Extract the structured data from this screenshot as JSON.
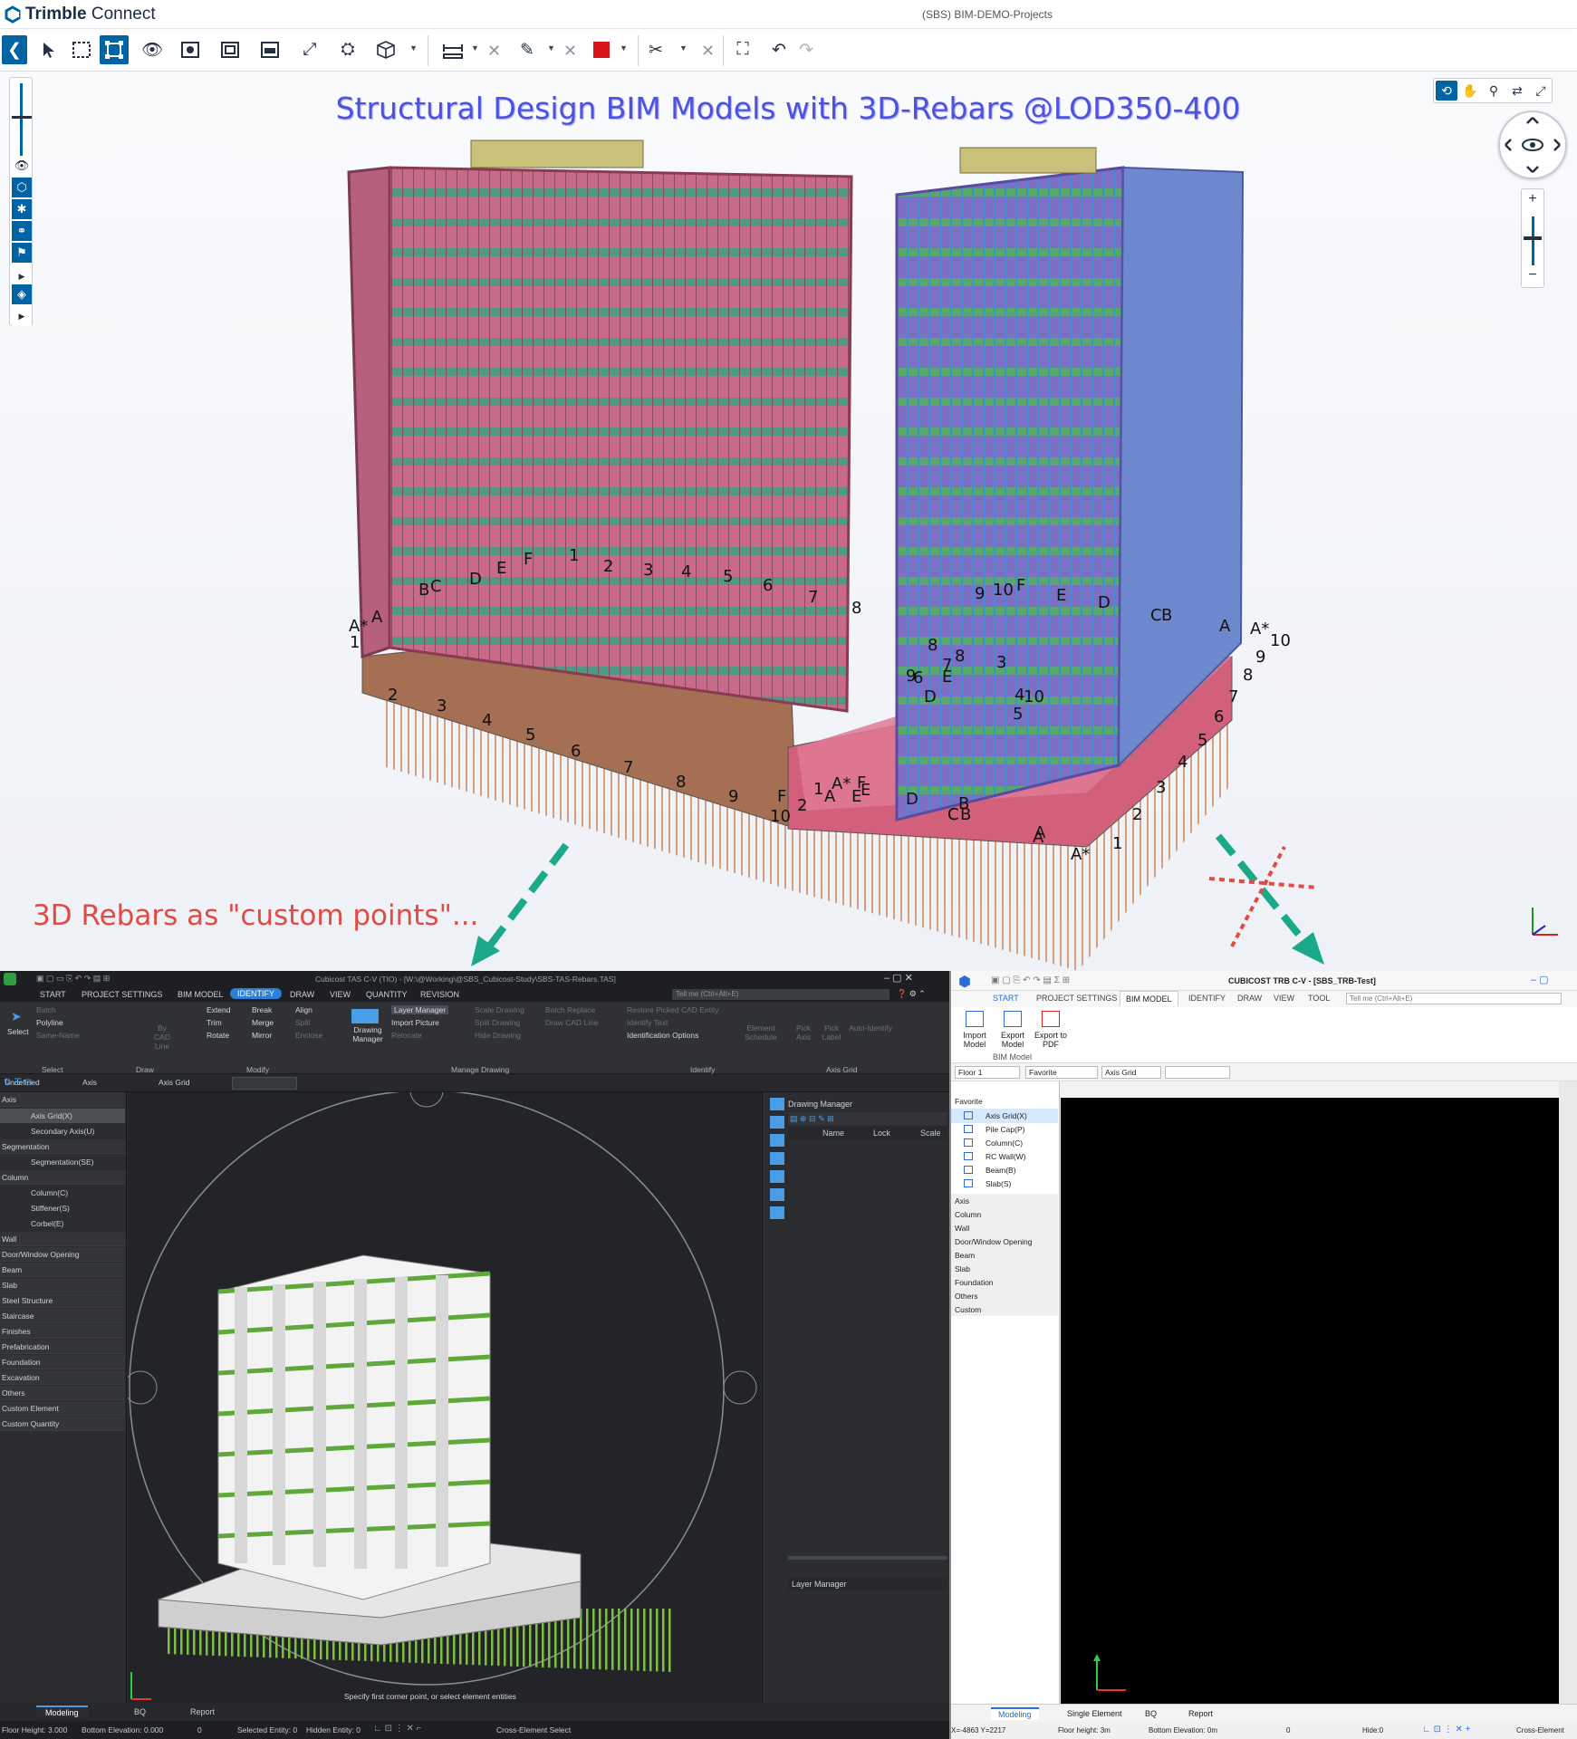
{
  "trimble": {
    "brand_bold": "Trimble",
    "brand_light": "Connect",
    "project": "(SBS) BIM-DEMO-Projects",
    "heading": "Structural Design BIM Models with 3D-Rebars @LOD350-400",
    "caption": "3D Rebars as \"custom points\"...",
    "zoom_plus": "+",
    "zoom_minus": "−",
    "grid_labels_left": [
      "A*",
      "A",
      "1",
      "B",
      "C",
      "D",
      "E",
      "F",
      "1",
      "2",
      "3",
      "4",
      "5",
      "6",
      "7",
      "8",
      "2",
      "3",
      "4",
      "5",
      "6",
      "7",
      "8",
      "9",
      "10",
      "1",
      "2",
      "F",
      "E",
      "A",
      "A*"
    ],
    "grid_labels_right": [
      "9",
      "10",
      "F",
      "E",
      "D",
      "C",
      "B",
      "A",
      "A*",
      "10",
      "9",
      "8",
      "7",
      "6",
      "5",
      "4",
      "3",
      "2",
      "1",
      "A*",
      "A",
      "B",
      "C",
      "D",
      "E",
      "F",
      "5",
      "4",
      "3",
      "8",
      "9",
      "6",
      "7",
      "8",
      "D",
      "E",
      "A",
      "C",
      "B",
      "10"
    ],
    "accent": "#0063a3"
  },
  "tas": {
    "title": "Cubicost TAS C-V (TIO) - [W:\\@Working\\@SBS_Cubicost-Study\\SBS-TAS-Rebars.TAS]",
    "tabs": [
      "START",
      "PROJECT SETTINGS",
      "BIM MODEL",
      "IDENTIFY",
      "DRAW",
      "VIEW",
      "QUANTITY",
      "REVISION"
    ],
    "tell_me": "Tell me (Ctrl+Alt+E)",
    "ribbon": {
      "select": "Select",
      "batch": "Batch",
      "polyline": "Polyline",
      "same_name": "Same-Name",
      "by_cad_line": "By CAD Line",
      "extend": "Extend",
      "break": "Break",
      "align": "Align",
      "trim": "Trim",
      "merge": "Merge",
      "split": "Split",
      "rotate": "Rotate",
      "mirror": "Mirror",
      "enclose": "Enclose",
      "drawing_manager": "Drawing Manager",
      "layer_manager": "Layer Manager",
      "import_picture": "Import Picture",
      "relocate": "Relocate",
      "scale_drawing": "Scale Drawing",
      "split_drawing": "Split Drawing",
      "hide_drawing": "Hide Drawing",
      "batch_replace": "Batch Replace",
      "draw_cad_line": "Draw CAD Line",
      "restore": "Restore Picked CAD Entity",
      "identify_text": "Identify Text",
      "identification_options": "Identification Options",
      "element_schedule": "Element Schedule",
      "pick_axis": "Pick Axis",
      "pick_label": "Pick Label",
      "auto_identify": "Auto-Identify"
    },
    "groups": [
      "Select",
      "Draw",
      "Modify",
      "Manage Drawing",
      "Identify",
      "Axis Grid"
    ],
    "filter": [
      "Undefined",
      "Axis",
      "Axis Grid",
      ""
    ],
    "tree": [
      {
        "t": "Axis",
        "k": "head"
      },
      {
        "t": "Axis Grid(X)",
        "k": "sel"
      },
      {
        "t": "Secondary Axis(U)",
        "k": "sub"
      },
      {
        "t": "Segmentation",
        "k": "head"
      },
      {
        "t": "Segmentation(SE)",
        "k": "sub"
      },
      {
        "t": "Column",
        "k": "head"
      },
      {
        "t": "Column(C)",
        "k": "sub"
      },
      {
        "t": "Stiffener(S)",
        "k": "sub"
      },
      {
        "t": "Corbel(E)",
        "k": "sub"
      },
      {
        "t": "Wall",
        "k": "head"
      },
      {
        "t": "Door/Window Opening",
        "k": "head"
      },
      {
        "t": "Beam",
        "k": "head"
      },
      {
        "t": "Slab",
        "k": "head"
      },
      {
        "t": "Steel Structure",
        "k": "head"
      },
      {
        "t": "Staircase",
        "k": "head"
      },
      {
        "t": "Finishes",
        "k": "head"
      },
      {
        "t": "Prefabrication",
        "k": "head"
      },
      {
        "t": "Foundation",
        "k": "head"
      },
      {
        "t": "Excavation",
        "k": "head"
      },
      {
        "t": "Others",
        "k": "head"
      },
      {
        "t": "Custom Element",
        "k": "head"
      },
      {
        "t": "Custom Quantity",
        "k": "head"
      }
    ],
    "drawing_manager": "Drawing Manager",
    "cols": [
      "Name",
      "Lock",
      "Scale"
    ],
    "layer_manager": "Layer Manager",
    "prompt": "Specify first corner point, or select element entities",
    "bottom_tabs": [
      "Modeling",
      "BQ",
      "Report"
    ],
    "status": {
      "floor_height": "Floor Height: 3.000",
      "bottom_elev": "Bottom Elevation: 0.000",
      "zero": "0",
      "selected": "Selected Entity: 0",
      "hidden": "Hidden Entity: 0",
      "cross": "Cross-Element Select"
    }
  },
  "trb": {
    "title": "CUBICOST TRB C-V - [SBS_TRB-Test]",
    "tabs": [
      "START",
      "PROJECT SETTINGS",
      "BIM MODEL",
      "IDENTIFY",
      "DRAW",
      "VIEW",
      "TOOL"
    ],
    "tell_me": "Tell me (Ctrl+Alt+E)",
    "buttons": [
      "Import Model",
      "Export Model",
      "Export to PDF"
    ],
    "group": "BIM Model",
    "filter": [
      "Floor 1",
      "Favorite",
      "Axis Grid",
      ""
    ],
    "favorite": "Favorite",
    "fav_items": [
      "Axis Grid(X)",
      "Pile Cap(P)",
      "Column(C)",
      "RC Wall(W)",
      "Beam(B)",
      "Slab(S)"
    ],
    "cats": [
      "Axis",
      "Column",
      "Wall",
      "Door/Window Opening",
      "Beam",
      "Slab",
      "Foundation",
      "Others",
      "Custom"
    ],
    "bottom_tabs": [
      "Modeling",
      "Single Element",
      "BQ",
      "Report"
    ],
    "status": {
      "xy": "X=-4863 Y=2217",
      "floor_height": "Floor height: 3m",
      "bottom_elev": "Bottom Elevation: 0m",
      "zero": "0",
      "hide": "Hide:0",
      "cross": "Cross-Element"
    }
  }
}
